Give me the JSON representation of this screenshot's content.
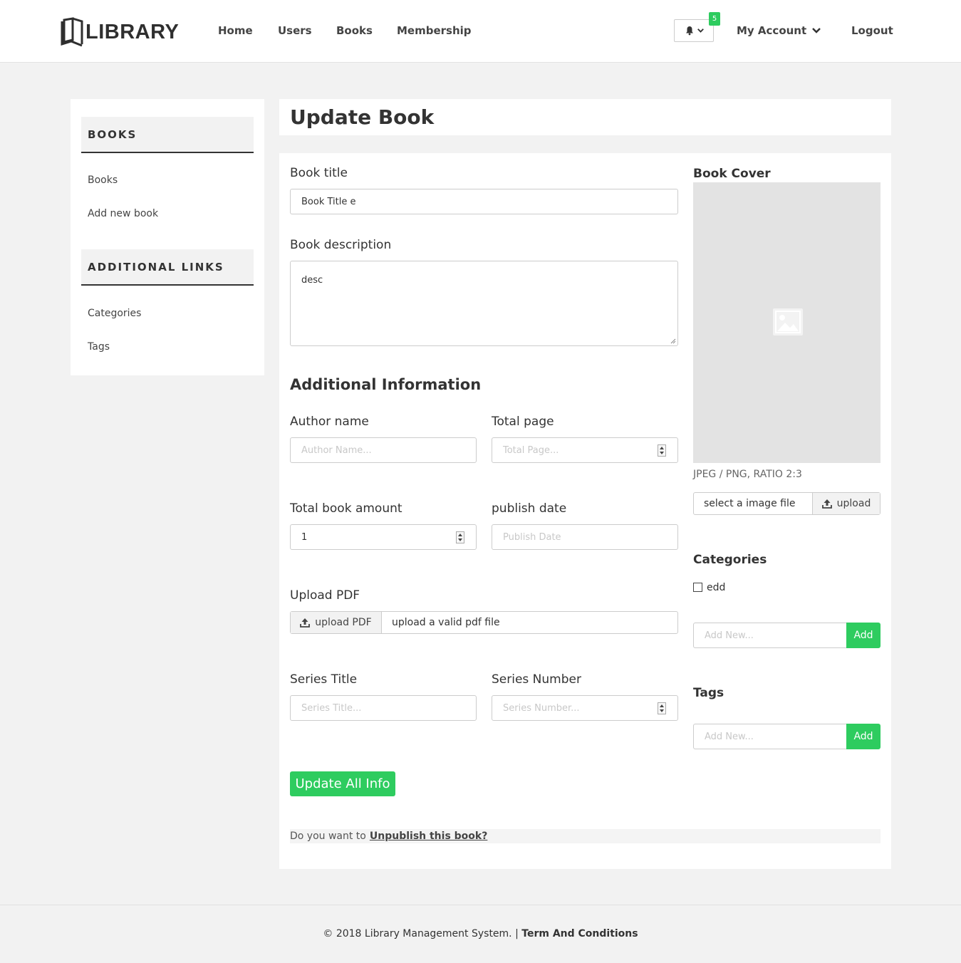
{
  "header": {
    "logo_text": "LIBRARY",
    "nav": [
      "Home",
      "Users",
      "Books",
      "Membership"
    ],
    "notification_count": "5",
    "account_label": "My Account",
    "logout_label": "Logout"
  },
  "sidebar": {
    "sections": [
      {
        "title": "BOOKS",
        "links": [
          "Books",
          "Add new book"
        ]
      },
      {
        "title": "ADDITIONAL LINKS",
        "links": [
          "Categories",
          "Tags"
        ]
      }
    ]
  },
  "page": {
    "title": "Update Book"
  },
  "form": {
    "book_title_label": "Book title",
    "book_title_value": "Book Title e",
    "book_description_label": "Book description",
    "book_description_value": "desc",
    "additional_info_title": "Additional Information",
    "author_label": "Author name",
    "author_placeholder": "Author Name...",
    "total_page_label": "Total page",
    "total_page_placeholder": "Total Page...",
    "total_amount_label": "Total book amount",
    "total_amount_value": "1",
    "publish_date_label": "publish date",
    "publish_date_placeholder": "Publish Date",
    "upload_pdf_label": "Upload PDF",
    "upload_pdf_button": "upload PDF",
    "upload_pdf_hint": "upload a valid pdf file",
    "series_title_label": "Series Title",
    "series_title_placeholder": "Series Title...",
    "series_number_label": "Series Number",
    "series_number_placeholder": "Series Number...",
    "update_button": "Update All Info",
    "unpublish_prefix": "Do you want to",
    "unpublish_link": "Unpublish this book?"
  },
  "cover": {
    "title": "Book Cover",
    "hint": "JPEG / PNG, RATIO 2:3",
    "file_text": "select a image file",
    "upload_button": "upload"
  },
  "categories": {
    "title": "Categories",
    "items": [
      {
        "label": "edd",
        "checked": false
      }
    ],
    "add_placeholder": "Add New...",
    "add_button": "Add"
  },
  "tags": {
    "title": "Tags",
    "add_placeholder": "Add New...",
    "add_button": "Add"
  },
  "footer": {
    "copyright": "© 2018 Library Management System. |",
    "terms_link": "Term And Conditions"
  },
  "colors": {
    "accent": "#2ecc5f",
    "background": "#f2f2f2",
    "text": "#333333"
  },
  "icons": [
    "book-logo-icon",
    "bell-icon",
    "chevron-down-icon",
    "upload-icon",
    "image-placeholder-icon",
    "resize-grip-icon",
    "number-spinner-icon"
  ]
}
